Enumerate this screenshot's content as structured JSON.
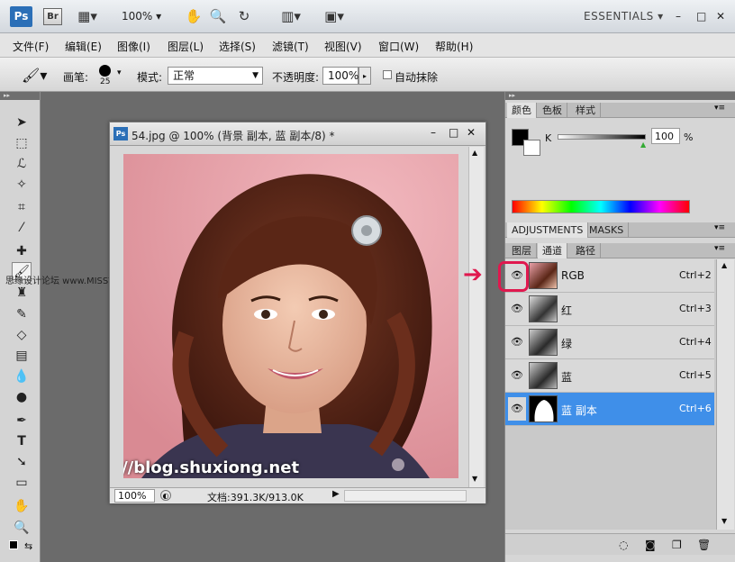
{
  "appbar": {
    "ps_label": "Ps",
    "br_label": "Br",
    "zoom": "100%",
    "workspace": "ESSENTIALS",
    "window_controls": [
      "–",
      "□",
      "✕"
    ]
  },
  "menu": [
    {
      "label": "文件(F)"
    },
    {
      "label": "编辑(E)"
    },
    {
      "label": "图像(I)"
    },
    {
      "label": "图层(L)"
    },
    {
      "label": "选择(S)"
    },
    {
      "label": "滤镜(T)"
    },
    {
      "label": "视图(V)"
    },
    {
      "label": "窗口(W)"
    },
    {
      "label": "帮助(H)"
    }
  ],
  "options": {
    "brush_label": "画笔:",
    "brush_size": "25",
    "mode_label": "模式:",
    "mode_value": "正常",
    "opacity_label": "不透明度:",
    "opacity_value": "100%",
    "auto_erase_label": "自动抹除"
  },
  "document": {
    "title": "54.jpg @ 100% (背景 副本, 蓝 副本/8) *",
    "zoom": "100%",
    "doc_size": "文档:391.3K/913.0K"
  },
  "watermark": {
    "url": "http://blog.shuxiong.net",
    "forum": "思缘设计论坛  www.MISSYUAN.com"
  },
  "color_panel": {
    "tabs": [
      "颜色",
      "色板",
      "样式"
    ],
    "slider_label": "K",
    "value": "100",
    "unit": "%"
  },
  "adjust_panel": {
    "tabs": [
      "ADJUSTMENTS",
      "MASKS"
    ]
  },
  "layers_panel": {
    "tabs": [
      "图层",
      "通道",
      "路径"
    ],
    "channels": [
      {
        "name": "RGB",
        "shortcut": "Ctrl+2"
      },
      {
        "name": "红",
        "shortcut": "Ctrl+3"
      },
      {
        "name": "绿",
        "shortcut": "Ctrl+4"
      },
      {
        "name": "蓝",
        "shortcut": "Ctrl+5"
      },
      {
        "name": "蓝 副本",
        "shortcut": "Ctrl+6"
      }
    ]
  },
  "colors": {
    "accent": "#3f8fe9",
    "annotation": "#e0184e",
    "ps_blue": "#2b6fb7"
  }
}
